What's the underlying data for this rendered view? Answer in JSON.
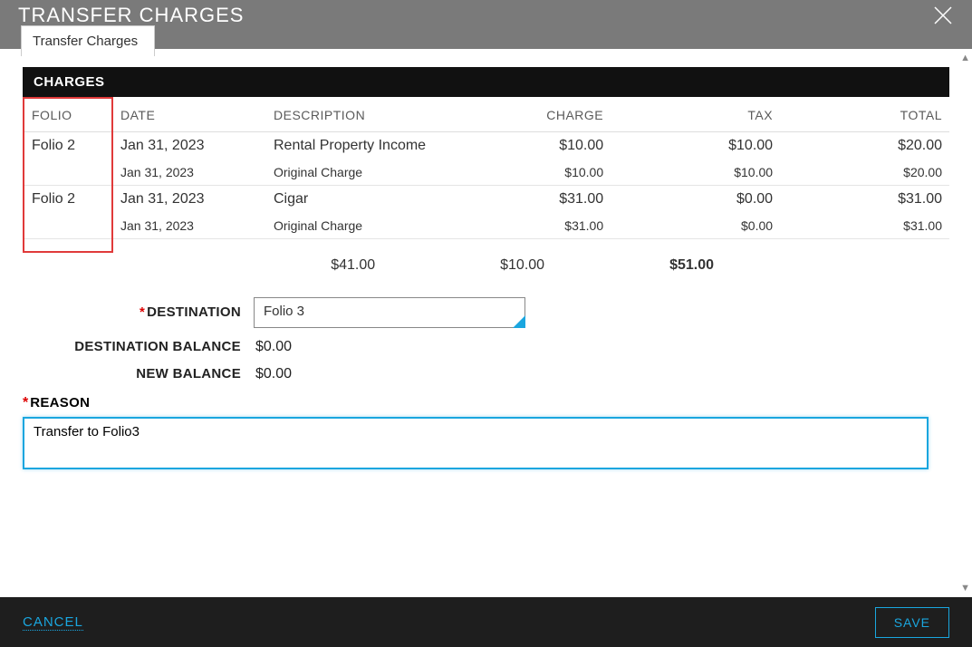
{
  "header": {
    "title": "TRANSFER CHARGES",
    "tab_label": "Transfer Charges"
  },
  "section_title": "CHARGES",
  "columns": {
    "folio": "FOLIO",
    "date": "DATE",
    "description": "DESCRIPTION",
    "charge": "CHARGE",
    "tax": "TAX",
    "total": "TOTAL"
  },
  "rows": [
    {
      "folio": "Folio 2",
      "date": "Jan 31, 2023",
      "description": "Rental Property Income",
      "charge": "$10.00",
      "tax": "$10.00",
      "total": "$20.00",
      "sub_date": "Jan 31, 2023",
      "sub_description": "Original Charge",
      "sub_charge": "$10.00",
      "sub_tax": "$10.00",
      "sub_total": "$20.00"
    },
    {
      "folio": "Folio 2",
      "date": "Jan 31, 2023",
      "description": "Cigar",
      "charge": "$31.00",
      "tax": "$0.00",
      "total": "$31.00",
      "sub_date": "Jan 31, 2023",
      "sub_description": "Original Charge",
      "sub_charge": "$31.00",
      "sub_tax": "$0.00",
      "sub_total": "$31.00"
    }
  ],
  "totals": {
    "charge": "$41.00",
    "tax": "$10.00",
    "total": "$51.00"
  },
  "form": {
    "destination_label": "DESTINATION",
    "destination_value": "Folio 3",
    "dest_balance_label": "DESTINATION BALANCE",
    "dest_balance_value": "$0.00",
    "new_balance_label": "NEW BALANCE",
    "new_balance_value": "$0.00",
    "reason_label": "REASON",
    "reason_value": "Transfer to Folio3"
  },
  "footer": {
    "cancel": "CANCEL",
    "save": "SAVE"
  }
}
